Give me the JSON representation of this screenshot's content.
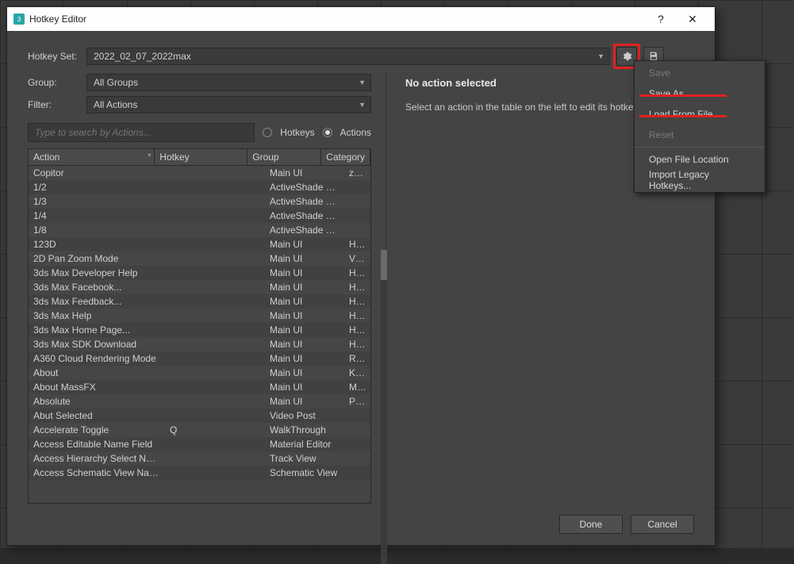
{
  "window": {
    "title": "Hotkey Editor",
    "help_glyph": "?",
    "close_glyph": "✕"
  },
  "hotkey_set": {
    "label": "Hotkey Set:",
    "value": "2022_02_07_2022max"
  },
  "group": {
    "label": "Group:",
    "value": "All Groups"
  },
  "filter": {
    "label": "Filter:",
    "value": "All Actions"
  },
  "search": {
    "placeholder": "Type to search by Actions..."
  },
  "radios": {
    "hotkeys": "Hotkeys",
    "actions": "Actions"
  },
  "columns": {
    "action": "Action",
    "hotkey": "Hotkey",
    "group": "Group",
    "category": "Category"
  },
  "rows": [
    {
      "action": "Copitor",
      "hotkey": "",
      "group": "Main UI",
      "category": "zOffTy To"
    },
    {
      "action": "1/2",
      "hotkey": "",
      "group": "ActiveShade Fra...",
      "category": ""
    },
    {
      "action": "1/3",
      "hotkey": "",
      "group": "ActiveShade Fra...",
      "category": ""
    },
    {
      "action": "1/4",
      "hotkey": "",
      "group": "ActiveShade Fra...",
      "category": ""
    },
    {
      "action": "1/8",
      "hotkey": "",
      "group": "ActiveShade Fra...",
      "category": ""
    },
    {
      "action": "123D",
      "hotkey": "",
      "group": "Main UI",
      "category": "Help"
    },
    {
      "action": "2D Pan Zoom Mode",
      "hotkey": "",
      "group": "Main UI",
      "category": "Views"
    },
    {
      "action": "3ds Max Developer Help",
      "hotkey": "",
      "group": "Main UI",
      "category": "Help"
    },
    {
      "action": "3ds Max Facebook...",
      "hotkey": "",
      "group": "Main UI",
      "category": "Help"
    },
    {
      "action": "3ds Max Feedback...",
      "hotkey": "",
      "group": "Main UI",
      "category": "Help"
    },
    {
      "action": "3ds Max Help",
      "hotkey": "",
      "group": "Main UI",
      "category": "Help"
    },
    {
      "action": "3ds Max Home Page...",
      "hotkey": "",
      "group": "Main UI",
      "category": "Help"
    },
    {
      "action": "3ds Max SDK Download",
      "hotkey": "",
      "group": "Main UI",
      "category": "Help"
    },
    {
      "action": "A360 Cloud Rendering Mode",
      "hotkey": "",
      "group": "Main UI",
      "category": "Render"
    },
    {
      "action": "About",
      "hotkey": "",
      "group": "Main UI",
      "category": "Kstudio"
    },
    {
      "action": "About MassFX",
      "hotkey": "",
      "group": "Main UI",
      "category": "MassFX"
    },
    {
      "action": "Absolute",
      "hotkey": "",
      "group": "Main UI",
      "category": "Parameter"
    },
    {
      "action": "Abut Selected",
      "hotkey": "",
      "group": "Video Post",
      "category": ""
    },
    {
      "action": "Accelerate Toggle",
      "hotkey": "Q",
      "group": "WalkThrough",
      "category": ""
    },
    {
      "action": "Access Editable Name Field",
      "hotkey": "",
      "group": "Material Editor",
      "category": ""
    },
    {
      "action": "Access Hierarchy Select Name Field",
      "hotkey": "",
      "group": "Track View",
      "category": ""
    },
    {
      "action": "Access Schematic View Name Field",
      "hotkey": "",
      "group": "Schematic View",
      "category": ""
    }
  ],
  "right_panel": {
    "heading": "No action selected",
    "hint": "Select an action in the table on the left to edit its hotkeys"
  },
  "footer": {
    "done": "Done",
    "cancel": "Cancel"
  },
  "menu": {
    "save": "Save",
    "save_as": "Save As...",
    "load": "Load From File...",
    "reset": "Reset",
    "open_loc": "Open File Location",
    "import_legacy": "Import Legacy Hotkeys..."
  }
}
